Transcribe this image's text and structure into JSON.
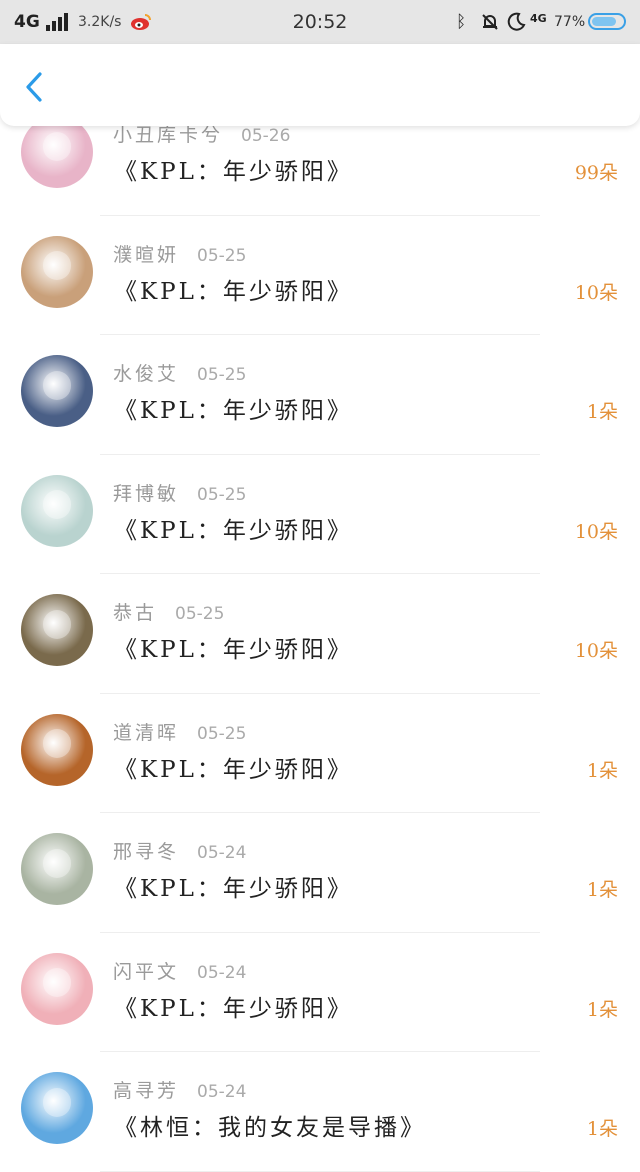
{
  "status_bar": {
    "network": "4G",
    "speed": "3.2K/s",
    "time": "20:52",
    "network2": "4G",
    "battery_pct": "77%"
  },
  "nav": {
    "back_icon": "chevron-left-icon",
    "accent": "#2b9be8"
  },
  "colors": {
    "count": "#e3913a",
    "name": "#9a9a9a",
    "title": "#222222"
  },
  "gifts": [
    {
      "name": "小丑库卡兮",
      "date": "05-26",
      "title": "《KPL：年少骄阳》",
      "count": "99朵",
      "avatar": "#e8b4c8"
    },
    {
      "name": "濮暄妍",
      "date": "05-25",
      "title": "《KPL：年少骄阳》",
      "count": "10朵",
      "avatar": "#c9a07a"
    },
    {
      "name": "水俊艾",
      "date": "05-25",
      "title": "《KPL：年少骄阳》",
      "count": "1朵",
      "avatar": "#4a5f86"
    },
    {
      "name": "拜博敏",
      "date": "05-25",
      "title": "《KPL：年少骄阳》",
      "count": "10朵",
      "avatar": "#b9d3cf"
    },
    {
      "name": "恭古",
      "date": "05-25",
      "title": "《KPL：年少骄阳》",
      "count": "10朵",
      "avatar": "#7a6a4c"
    },
    {
      "name": "道清晖",
      "date": "05-25",
      "title": "《KPL：年少骄阳》",
      "count": "1朵",
      "avatar": "#b5652a"
    },
    {
      "name": "邢寻冬",
      "date": "05-24",
      "title": "《KPL：年少骄阳》",
      "count": "1朵",
      "avatar": "#a9b4a2"
    },
    {
      "name": "闪平文",
      "date": "05-24",
      "title": "《KPL：年少骄阳》",
      "count": "1朵",
      "avatar": "#f0b0b8"
    },
    {
      "name": "高寻芳",
      "date": "05-24",
      "title": "《林恒：我的女友是导播》",
      "count": "1朵",
      "avatar": "#5fa8e0"
    }
  ]
}
